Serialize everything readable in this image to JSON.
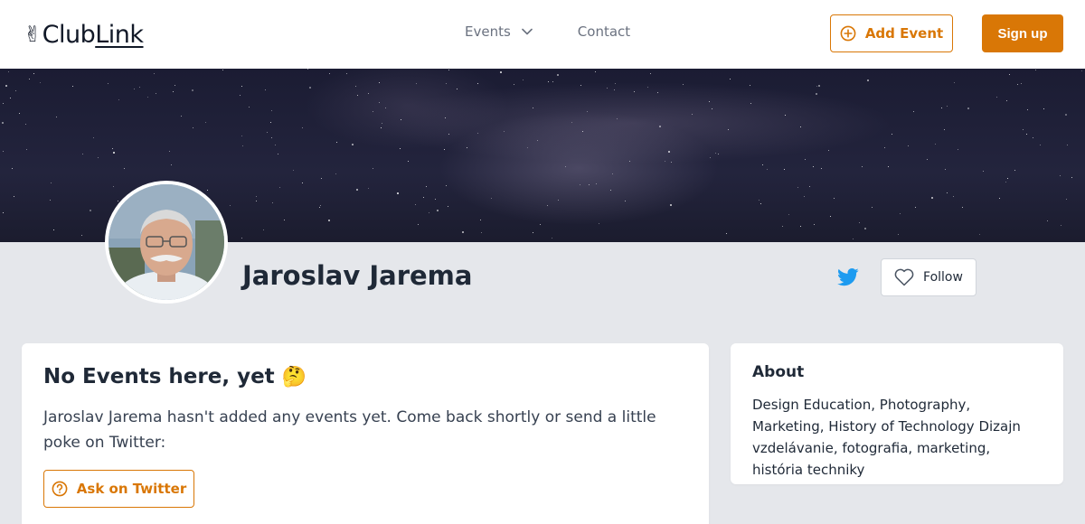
{
  "header": {
    "logo_prefix": "Club",
    "logo_suffix": "Link",
    "nav": {
      "events_label": "Events",
      "contact_label": "Contact"
    },
    "add_event_label": "Add Event",
    "signup_label": "Sign up"
  },
  "profile": {
    "name": "Jaroslav Jarema",
    "follow_label": "Follow"
  },
  "events_card": {
    "title": "No Events here, yet",
    "emoji": "🤔",
    "message": "Jaroslav Jarema hasn't added any events yet. Come back shortly or send a little poke on Twitter:",
    "ask_label": "Ask on Twitter"
  },
  "about_card": {
    "title": "About",
    "text": "Design Education, Photography, Marketing, History of Technology Dizajn vzdelávanie, fotografia, marketing, história techniky"
  },
  "colors": {
    "accent": "#d97706",
    "background": "#e5e7eb",
    "twitter": "#1d9bf0"
  },
  "icons": {
    "logo": "victory-hand-icon",
    "events_dropdown": "chevron-down-icon",
    "add_event": "plus-circle-icon",
    "twitter": "twitter-icon",
    "follow": "heart-icon",
    "ask": "question-circle-icon"
  }
}
